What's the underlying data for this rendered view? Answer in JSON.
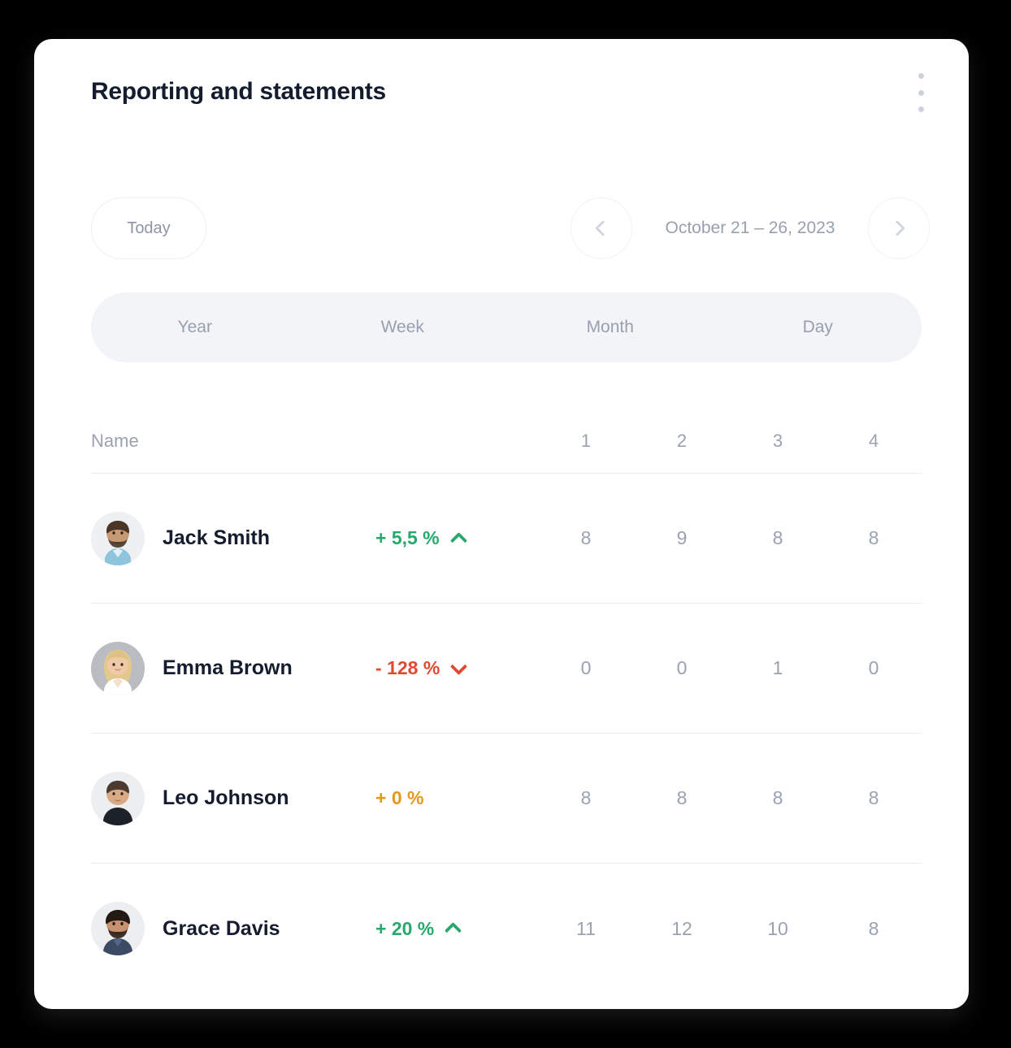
{
  "header": {
    "title": "Reporting and statements",
    "menu_icon": "kebab-vertical-icon"
  },
  "date_bar": {
    "today_label": "Today",
    "range_label": "October 21 – 26, 2023",
    "prev_icon": "chevron-left-icon",
    "next_icon": "chevron-right-icon"
  },
  "period_tabs": {
    "items": [
      {
        "label": "Year"
      },
      {
        "label": "Week"
      },
      {
        "label": "Month"
      },
      {
        "label": "Day"
      }
    ],
    "selected": null
  },
  "table": {
    "columns": {
      "name": "Name",
      "delta": "",
      "numbers": [
        "1",
        "2",
        "3",
        "4"
      ]
    },
    "rows": [
      {
        "name": "Jack Smith",
        "delta": "+ 5,5 %",
        "trend": "up",
        "trend_icon": "chevron-up-icon",
        "values": [
          "8",
          "9",
          "8",
          "8"
        ]
      },
      {
        "name": "Emma Brown",
        "delta": "- 128 %",
        "trend": "down",
        "trend_icon": "chevron-down-icon",
        "values": [
          "0",
          "0",
          "1",
          "0"
        ]
      },
      {
        "name": "Leo Johnson",
        "delta": "+ 0 %",
        "trend": "flat",
        "trend_icon": "",
        "values": [
          "8",
          "8",
          "8",
          "8"
        ]
      },
      {
        "name": "Grace Davis",
        "delta": "+ 20 %",
        "trend": "up",
        "trend_icon": "chevron-up-icon",
        "values": [
          "11",
          "12",
          "10",
          "8"
        ]
      }
    ]
  },
  "colors": {
    "title": "#141c2e",
    "muted": "#98a0b0",
    "divider": "#ebedf1",
    "segmented_bg": "#f2f4f7",
    "positive": "#27a96e",
    "negative": "#e04a33",
    "neutral": "#e8971e",
    "card_bg": "#ffffff",
    "page_bg": "#000000"
  }
}
